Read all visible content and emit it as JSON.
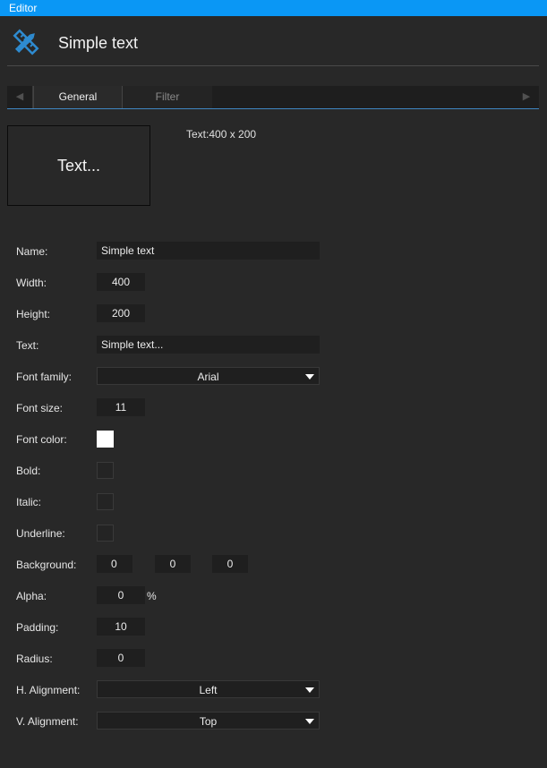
{
  "window": {
    "title": "Editor"
  },
  "header": {
    "title": "Simple text",
    "icon": "ruler-pencil-icon"
  },
  "tabs": {
    "prev_icon": "chevron-left-icon",
    "next_icon": "chevron-right-icon",
    "items": [
      {
        "label": "General",
        "active": true
      },
      {
        "label": "Filter",
        "active": false
      }
    ]
  },
  "preview": {
    "text": "Text...",
    "dimensions": "Text:400 x 200"
  },
  "form": {
    "name": {
      "label": "Name:",
      "value": "Simple text"
    },
    "width": {
      "label": "Width:",
      "value": "400"
    },
    "height": {
      "label": "Height:",
      "value": "200"
    },
    "text": {
      "label": "Text:",
      "value": "Simple text..."
    },
    "font_family": {
      "label": "Font family:",
      "value": "Arial"
    },
    "font_size": {
      "label": "Font size:",
      "value": "11"
    },
    "font_color": {
      "label": "Font color:",
      "color": "#ffffff"
    },
    "bold": {
      "label": "Bold:",
      "checked": false
    },
    "italic": {
      "label": "Italic:",
      "checked": false
    },
    "underline": {
      "label": "Underline:",
      "checked": false
    },
    "background": {
      "label": "Background:",
      "r": "0",
      "g": "0",
      "b": "0"
    },
    "alpha": {
      "label": "Alpha:",
      "value": "0",
      "unit": "%"
    },
    "padding": {
      "label": "Padding:",
      "value": "10"
    },
    "radius": {
      "label": "Radius:",
      "value": "0"
    },
    "h_alignment": {
      "label": "H. Alignment:",
      "value": "Left"
    },
    "v_alignment": {
      "label": "V. Alignment:",
      "value": "Top"
    }
  },
  "colors": {
    "titlebar": "#0a97f5",
    "accent": "#3f86c2",
    "background": "#282828",
    "icon": "#2e8bd0"
  }
}
